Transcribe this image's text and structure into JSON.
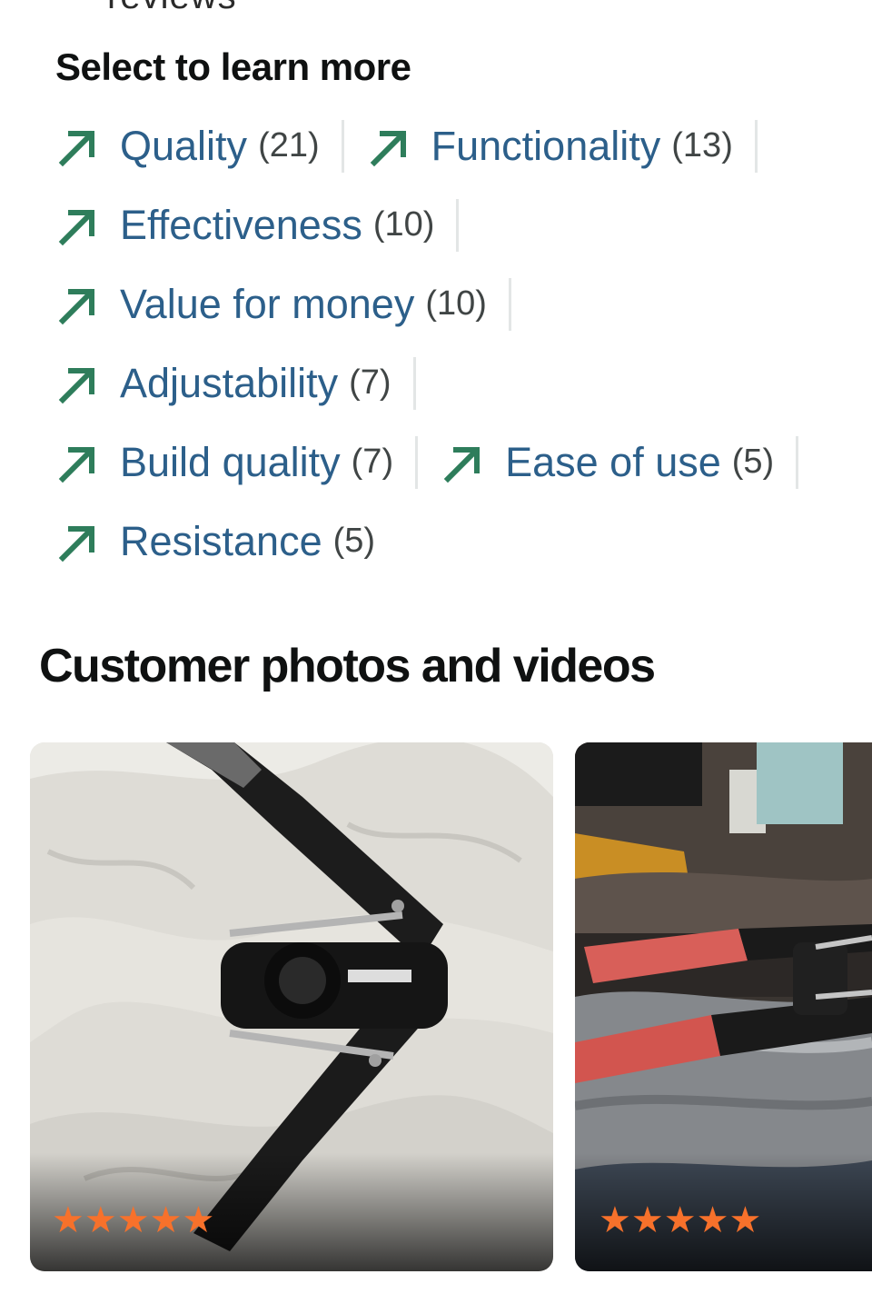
{
  "cutoff_text": "reviews",
  "aspects_section": {
    "heading": "Select to learn more",
    "rows": [
      [
        {
          "label": "Quality",
          "count": "(21)"
        },
        {
          "label": "Functionality",
          "count": "(13)"
        }
      ],
      [
        {
          "label": "Effectiveness",
          "count": "(10)"
        }
      ],
      [
        {
          "label": "Value for money",
          "count": "(10)"
        }
      ],
      [
        {
          "label": "Adjustability",
          "count": "(7)"
        }
      ],
      [
        {
          "label": "Build quality",
          "count": "(7)"
        },
        {
          "label": "Ease of use",
          "count": "(5)"
        }
      ],
      [
        {
          "label": "Resistance",
          "count": "(5)"
        }
      ]
    ],
    "arrow_icon": "trending-up-arrow-icon",
    "arrow_color": "#2e7d5b",
    "label_color": "#2c5f8a"
  },
  "photos_section": {
    "heading": "Customer photos and videos",
    "photos": [
      {
        "rating": 5,
        "stars": "★★★★★"
      },
      {
        "rating": 5,
        "stars": "★★★★★"
      }
    ],
    "star_color": "#f7712b"
  }
}
